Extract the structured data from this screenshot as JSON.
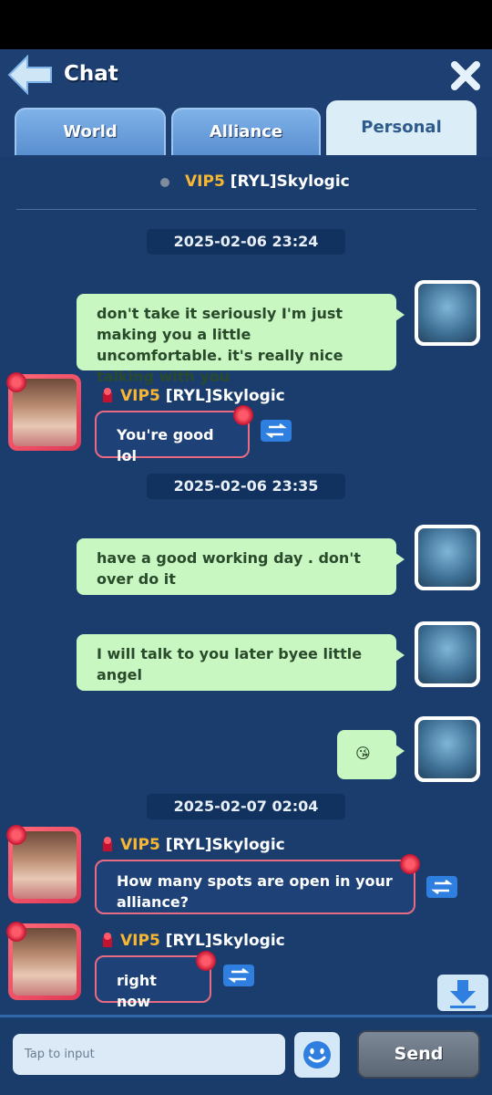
{
  "header": {
    "title": "Chat",
    "tabs": [
      {
        "label": "World"
      },
      {
        "label": "Alliance"
      },
      {
        "label": "Personal"
      }
    ]
  },
  "conversation": {
    "peer": {
      "vip": "VIP5",
      "name": "[RYL]Skylogic"
    }
  },
  "messages": {
    "ts1": "2025-02-06 23:24",
    "m1": "don't take it seriously I'm just making you a little uncomfortable. it's really nice talking with you",
    "p1_vip": "VIP5",
    "p1_name": "[RYL]Skylogic",
    "p1": "You're good lol",
    "ts2": "2025-02-06 23:35",
    "m2": "have a good working day . don't over do it",
    "m3": "I will talk to you later byee little angel",
    "m4": "😘",
    "ts3": "2025-02-07 02:04",
    "p2_vip": "VIP5",
    "p2_name": "[RYL]Skylogic",
    "p2": "How many spots are open in your alliance?",
    "p3_vip": "VIP5",
    "p3_name": "[RYL]Skylogic",
    "p3": "right now"
  },
  "composer": {
    "placeholder": "Tap to input",
    "send_label": "Send"
  },
  "colors": {
    "background": "#1b3d6e",
    "my_bubble": "#c8f7c1",
    "vip_gold": "#f7b733",
    "translate_blue": "#2f7fe0",
    "active_tab": "#dbeef7"
  },
  "icons": {
    "back": "back-arrow-icon",
    "close": "close-icon",
    "translate": "translate-icon",
    "download": "download-icon",
    "emoji": "emoji-icon"
  }
}
